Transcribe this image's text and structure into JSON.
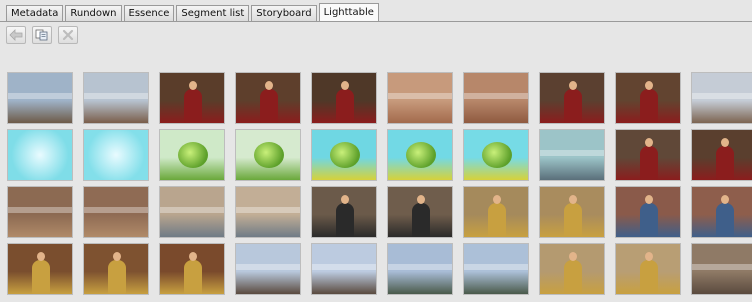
{
  "tabs": [
    {
      "label": "Metadata",
      "active": false
    },
    {
      "label": "Rundown",
      "active": false
    },
    {
      "label": "Essence",
      "active": false
    },
    {
      "label": "Segment list",
      "active": false
    },
    {
      "label": "Storyboard",
      "active": false
    },
    {
      "label": "Lighttable",
      "active": true
    }
  ],
  "toolbar": {
    "buttons": [
      {
        "name": "back-icon",
        "enabled": false
      },
      {
        "name": "copy-icon",
        "enabled": true
      },
      {
        "name": "delete-icon",
        "enabled": false
      }
    ]
  },
  "thumbnails": [
    {
      "scene": "crowd-wide",
      "bg": "#9fb3c8",
      "fg": "#6d5a48"
    },
    {
      "scene": "crowd-wide",
      "bg": "#b7c3d0",
      "fg": "#7a5e4a"
    },
    {
      "scene": "singer-red",
      "bg": "#5a3d2a",
      "fg": "#8b1d1d"
    },
    {
      "scene": "singer-red",
      "bg": "#5e3f2c",
      "fg": "#8b1d1d"
    },
    {
      "scene": "singer-red",
      "bg": "#4f3828",
      "fg": "#8b1d1d"
    },
    {
      "scene": "crowd-hands",
      "bg": "#c79a7c",
      "fg": "#a36a4c"
    },
    {
      "scene": "crowd-hands",
      "bg": "#b7876a",
      "fg": "#8f5a40"
    },
    {
      "scene": "singer-red",
      "bg": "#5b4030",
      "fg": "#8b1d1d"
    },
    {
      "scene": "singer-red",
      "bg": "#624430",
      "fg": "#8b1d1d"
    },
    {
      "scene": "crowd-wide",
      "bg": "#c5ccd6",
      "fg": "#7c6450"
    },
    {
      "scene": "cyan-burst",
      "bg": "#7fdde8",
      "fg": "#e9fbff"
    },
    {
      "scene": "cyan-burst",
      "bg": "#83dfea",
      "fg": "#e9fbff"
    },
    {
      "scene": "globe",
      "bg": "#cfe9c8",
      "fg": "#6aa83a"
    },
    {
      "scene": "globe",
      "bg": "#d6eacf",
      "fg": "#6aa83a"
    },
    {
      "scene": "globe-cyan",
      "bg": "#6fd7e3",
      "fg": "#d6d23a"
    },
    {
      "scene": "globe-cyan",
      "bg": "#72d9e5",
      "fg": "#d6d23a"
    },
    {
      "scene": "globe-cyan",
      "bg": "#76dbe6",
      "fg": "#d6d23a"
    },
    {
      "scene": "stage-wide",
      "bg": "#9cc4c8",
      "fg": "#5a6f7a"
    },
    {
      "scene": "singer-red",
      "bg": "#604838",
      "fg": "#8b1d1d"
    },
    {
      "scene": "singer-red",
      "bg": "#5a3f2e",
      "fg": "#8b1d1d"
    },
    {
      "scene": "crowd-close",
      "bg": "#8c6a52",
      "fg": "#b08a68"
    },
    {
      "scene": "crowd-close",
      "bg": "#8f6b54",
      "fg": "#b08a68"
    },
    {
      "scene": "street",
      "bg": "#b9a58e",
      "fg": "#6f7b86"
    },
    {
      "scene": "street",
      "bg": "#c2ae96",
      "fg": "#6f7b86"
    },
    {
      "scene": "piano",
      "bg": "#6b5a4a",
      "fg": "#2a2a2a"
    },
    {
      "scene": "piano",
      "bg": "#6f5d4c",
      "fg": "#2a2a2a"
    },
    {
      "scene": "singer-gold",
      "bg": "#a58a5c",
      "fg": "#c8a040"
    },
    {
      "scene": "singer-gold",
      "bg": "#a98c5e",
      "fg": "#c8a040"
    },
    {
      "scene": "guitar",
      "bg": "#8a5a4a",
      "fg": "#3f5f8a"
    },
    {
      "scene": "guitar",
      "bg": "#8e5e4c",
      "fg": "#3f5f8a"
    },
    {
      "scene": "singer-gold",
      "bg": "#7a4e2e",
      "fg": "#c8a040"
    },
    {
      "scene": "singer-gold",
      "bg": "#7e5230",
      "fg": "#c8a040"
    },
    {
      "scene": "singer-gold",
      "bg": "#7a4a2c",
      "fg": "#c8a040"
    },
    {
      "scene": "crowd-sky",
      "bg": "#b8c8dc",
      "fg": "#5a4a3e"
    },
    {
      "scene": "crowd-sky",
      "bg": "#bccbe0",
      "fg": "#5a4a3e"
    },
    {
      "scene": "field-sky",
      "bg": "#a8bcd6",
      "fg": "#4a5a4a"
    },
    {
      "scene": "field-sky",
      "bg": "#acc0d8",
      "fg": "#4a5a4a"
    },
    {
      "scene": "singer-gold",
      "bg": "#b49a70",
      "fg": "#c8a040"
    },
    {
      "scene": "singer-gold",
      "bg": "#b89e74",
      "fg": "#c8a040"
    },
    {
      "scene": "crowd-wide",
      "bg": "#8f7a66",
      "fg": "#5a4a3e"
    }
  ]
}
